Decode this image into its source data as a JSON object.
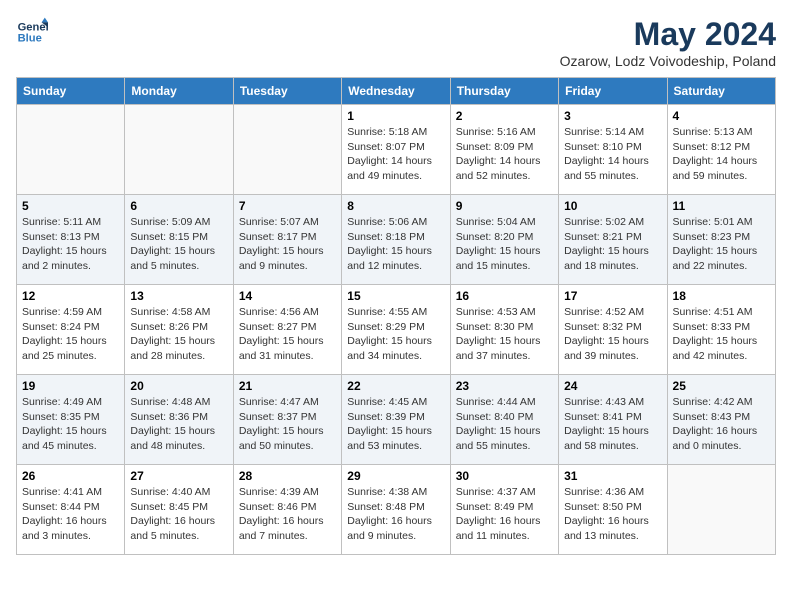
{
  "logo": {
    "line1": "General",
    "line2": "Blue"
  },
  "title": "May 2024",
  "subtitle": "Ozarow, Lodz Voivodeship, Poland",
  "days_of_week": [
    "Sunday",
    "Monday",
    "Tuesday",
    "Wednesday",
    "Thursday",
    "Friday",
    "Saturday"
  ],
  "weeks": [
    [
      {
        "day": "",
        "info": ""
      },
      {
        "day": "",
        "info": ""
      },
      {
        "day": "",
        "info": ""
      },
      {
        "day": "1",
        "info": "Sunrise: 5:18 AM\nSunset: 8:07 PM\nDaylight: 14 hours\nand 49 minutes."
      },
      {
        "day": "2",
        "info": "Sunrise: 5:16 AM\nSunset: 8:09 PM\nDaylight: 14 hours\nand 52 minutes."
      },
      {
        "day": "3",
        "info": "Sunrise: 5:14 AM\nSunset: 8:10 PM\nDaylight: 14 hours\nand 55 minutes."
      },
      {
        "day": "4",
        "info": "Sunrise: 5:13 AM\nSunset: 8:12 PM\nDaylight: 14 hours\nand 59 minutes."
      }
    ],
    [
      {
        "day": "5",
        "info": "Sunrise: 5:11 AM\nSunset: 8:13 PM\nDaylight: 15 hours\nand 2 minutes."
      },
      {
        "day": "6",
        "info": "Sunrise: 5:09 AM\nSunset: 8:15 PM\nDaylight: 15 hours\nand 5 minutes."
      },
      {
        "day": "7",
        "info": "Sunrise: 5:07 AM\nSunset: 8:17 PM\nDaylight: 15 hours\nand 9 minutes."
      },
      {
        "day": "8",
        "info": "Sunrise: 5:06 AM\nSunset: 8:18 PM\nDaylight: 15 hours\nand 12 minutes."
      },
      {
        "day": "9",
        "info": "Sunrise: 5:04 AM\nSunset: 8:20 PM\nDaylight: 15 hours\nand 15 minutes."
      },
      {
        "day": "10",
        "info": "Sunrise: 5:02 AM\nSunset: 8:21 PM\nDaylight: 15 hours\nand 18 minutes."
      },
      {
        "day": "11",
        "info": "Sunrise: 5:01 AM\nSunset: 8:23 PM\nDaylight: 15 hours\nand 22 minutes."
      }
    ],
    [
      {
        "day": "12",
        "info": "Sunrise: 4:59 AM\nSunset: 8:24 PM\nDaylight: 15 hours\nand 25 minutes."
      },
      {
        "day": "13",
        "info": "Sunrise: 4:58 AM\nSunset: 8:26 PM\nDaylight: 15 hours\nand 28 minutes."
      },
      {
        "day": "14",
        "info": "Sunrise: 4:56 AM\nSunset: 8:27 PM\nDaylight: 15 hours\nand 31 minutes."
      },
      {
        "day": "15",
        "info": "Sunrise: 4:55 AM\nSunset: 8:29 PM\nDaylight: 15 hours\nand 34 minutes."
      },
      {
        "day": "16",
        "info": "Sunrise: 4:53 AM\nSunset: 8:30 PM\nDaylight: 15 hours\nand 37 minutes."
      },
      {
        "day": "17",
        "info": "Sunrise: 4:52 AM\nSunset: 8:32 PM\nDaylight: 15 hours\nand 39 minutes."
      },
      {
        "day": "18",
        "info": "Sunrise: 4:51 AM\nSunset: 8:33 PM\nDaylight: 15 hours\nand 42 minutes."
      }
    ],
    [
      {
        "day": "19",
        "info": "Sunrise: 4:49 AM\nSunset: 8:35 PM\nDaylight: 15 hours\nand 45 minutes."
      },
      {
        "day": "20",
        "info": "Sunrise: 4:48 AM\nSunset: 8:36 PM\nDaylight: 15 hours\nand 48 minutes."
      },
      {
        "day": "21",
        "info": "Sunrise: 4:47 AM\nSunset: 8:37 PM\nDaylight: 15 hours\nand 50 minutes."
      },
      {
        "day": "22",
        "info": "Sunrise: 4:45 AM\nSunset: 8:39 PM\nDaylight: 15 hours\nand 53 minutes."
      },
      {
        "day": "23",
        "info": "Sunrise: 4:44 AM\nSunset: 8:40 PM\nDaylight: 15 hours\nand 55 minutes."
      },
      {
        "day": "24",
        "info": "Sunrise: 4:43 AM\nSunset: 8:41 PM\nDaylight: 15 hours\nand 58 minutes."
      },
      {
        "day": "25",
        "info": "Sunrise: 4:42 AM\nSunset: 8:43 PM\nDaylight: 16 hours\nand 0 minutes."
      }
    ],
    [
      {
        "day": "26",
        "info": "Sunrise: 4:41 AM\nSunset: 8:44 PM\nDaylight: 16 hours\nand 3 minutes."
      },
      {
        "day": "27",
        "info": "Sunrise: 4:40 AM\nSunset: 8:45 PM\nDaylight: 16 hours\nand 5 minutes."
      },
      {
        "day": "28",
        "info": "Sunrise: 4:39 AM\nSunset: 8:46 PM\nDaylight: 16 hours\nand 7 minutes."
      },
      {
        "day": "29",
        "info": "Sunrise: 4:38 AM\nSunset: 8:48 PM\nDaylight: 16 hours\nand 9 minutes."
      },
      {
        "day": "30",
        "info": "Sunrise: 4:37 AM\nSunset: 8:49 PM\nDaylight: 16 hours\nand 11 minutes."
      },
      {
        "day": "31",
        "info": "Sunrise: 4:36 AM\nSunset: 8:50 PM\nDaylight: 16 hours\nand 13 minutes."
      },
      {
        "day": "",
        "info": ""
      }
    ]
  ]
}
